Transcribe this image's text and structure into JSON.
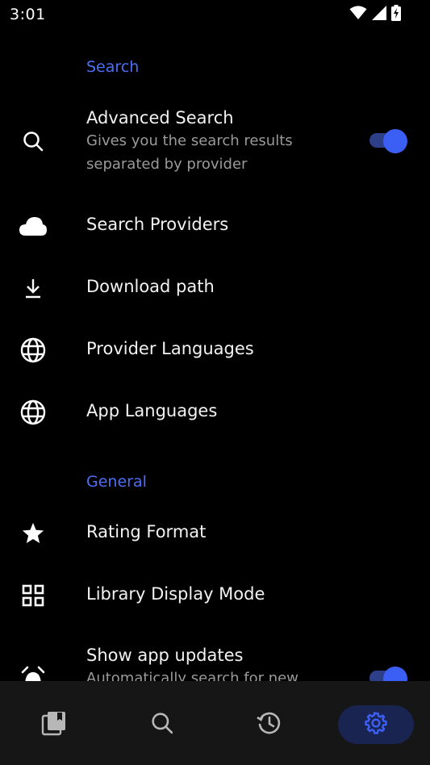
{
  "status_bar": {
    "time": "3:01",
    "icons": [
      "wifi-icon",
      "cellular-signal-icon",
      "battery-charging-icon"
    ]
  },
  "sections": {
    "search": {
      "header": "Search",
      "items": [
        {
          "icon": "search-icon",
          "title": "Advanced Search",
          "subtitle": "Gives you the search results separated by provider",
          "toggle": true
        },
        {
          "icon": "cloud-icon",
          "title": "Search Providers"
        },
        {
          "icon": "download-icon",
          "title": "Download path"
        },
        {
          "icon": "globe-icon",
          "title": "Provider Languages"
        },
        {
          "icon": "globe-icon",
          "title": "App Languages"
        }
      ]
    },
    "general": {
      "header": "General",
      "items": [
        {
          "icon": "star-icon",
          "title": "Rating Format"
        },
        {
          "icon": "grid-icon",
          "title": "Library Display Mode"
        },
        {
          "icon": "alarm-icon",
          "title": "Show app updates",
          "subtitle": "Automatically search for new",
          "toggle": true
        }
      ]
    }
  },
  "bottom_nav": {
    "items": [
      {
        "icon": "library-icon",
        "active": false
      },
      {
        "icon": "search-icon",
        "active": false
      },
      {
        "icon": "history-icon",
        "active": false
      },
      {
        "icon": "settings-icon",
        "active": true
      }
    ]
  },
  "colors": {
    "accent": "#4d6ef6",
    "toggle_thumb": "#3b5ff4",
    "toggle_track": "#2c3f88",
    "nav_active_bg": "#1a2450",
    "nav_bg": "#161616",
    "background": "#000000"
  }
}
